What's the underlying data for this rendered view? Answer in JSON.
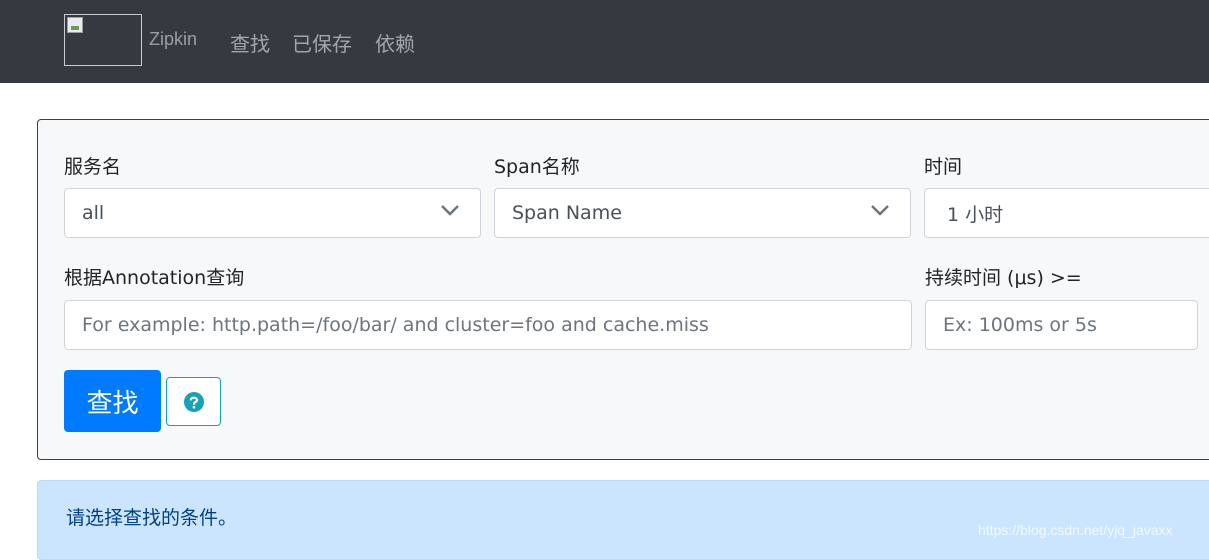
{
  "navbar": {
    "brand": "Zipkin",
    "links": [
      "查找",
      "已保存",
      "依赖"
    ]
  },
  "search": {
    "service_label": "服务名",
    "service_value": "all",
    "span_label": "Span名称",
    "span_value": "Span Name",
    "time_label": "时间",
    "time_value": "1 小时",
    "annotation_label": "根据Annotation查询",
    "annotation_placeholder": "For example: http.path=/foo/bar/ and cluster=foo and cache.miss",
    "duration_label": "持续时间 (μs) >=",
    "duration_placeholder": "Ex: 100ms or 5s",
    "find_button": "查找",
    "help_icon": "question-circle-icon"
  },
  "alert": {
    "message": "请选择查找的条件。"
  },
  "watermark": "https://blog.csdn.net/yjq_javaxx",
  "colors": {
    "navbar": "#343a40",
    "primary": "#007bff",
    "info": "#17a2b8",
    "alert_bg": "#cce5ff",
    "alert_text": "#004085"
  }
}
